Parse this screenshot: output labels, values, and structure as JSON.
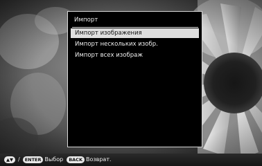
{
  "menu": {
    "title": "Импорт",
    "items": [
      {
        "label": "Импорт изображения",
        "selected": true
      },
      {
        "label": "Импорт нескольких изобр.",
        "selected": false
      },
      {
        "label": "Импорт всех изображ",
        "selected": false
      }
    ]
  },
  "footer": {
    "arrows_icon": "up-down-arrows-icon",
    "enter_key": "ENTER",
    "enter_label": "Выбор",
    "back_key": "BACK",
    "back_label": "Возврат."
  },
  "colors": {
    "selected_bg": "#dedede",
    "menu_bg": "#000000",
    "menu_border": "#d8d8d8"
  }
}
